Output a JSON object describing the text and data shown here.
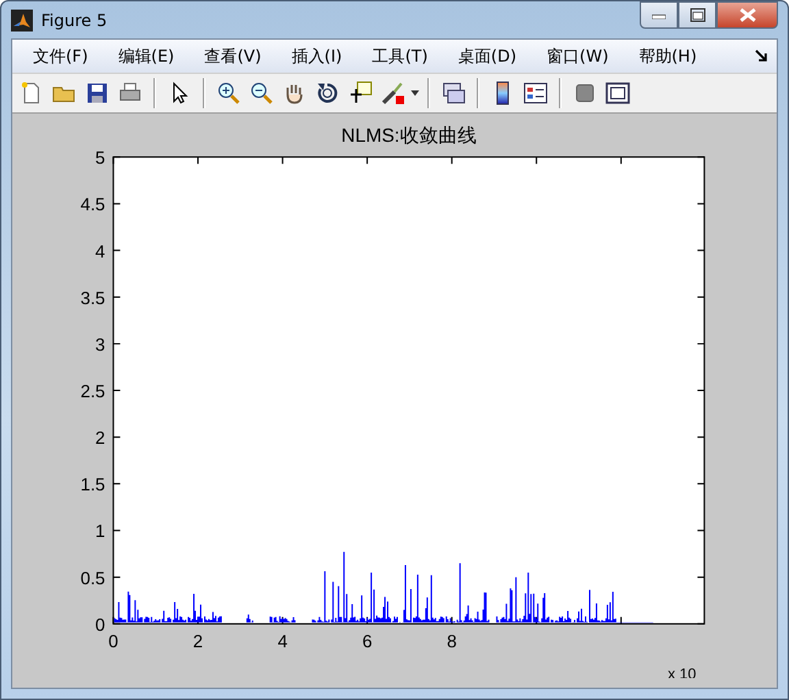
{
  "window": {
    "title": "Figure 5"
  },
  "menu": [
    {
      "label": "文件(F)"
    },
    {
      "label": "编辑(E)"
    },
    {
      "label": "查看(V)"
    },
    {
      "label": "插入(I)"
    },
    {
      "label": "工具(T)"
    },
    {
      "label": "桌面(D)"
    },
    {
      "label": "窗口(W)"
    },
    {
      "label": "帮助(H)"
    }
  ],
  "plot": {
    "title": "NLMS:收敛曲线",
    "yticks": [
      "5",
      "4.5",
      "4",
      "3.5",
      "3",
      "2.5",
      "2",
      "1.5",
      "1",
      "0.5",
      "0"
    ],
    "xticks": [
      "0",
      "2",
      "4",
      "6",
      "8"
    ],
    "x_exponent": "x 10"
  }
}
